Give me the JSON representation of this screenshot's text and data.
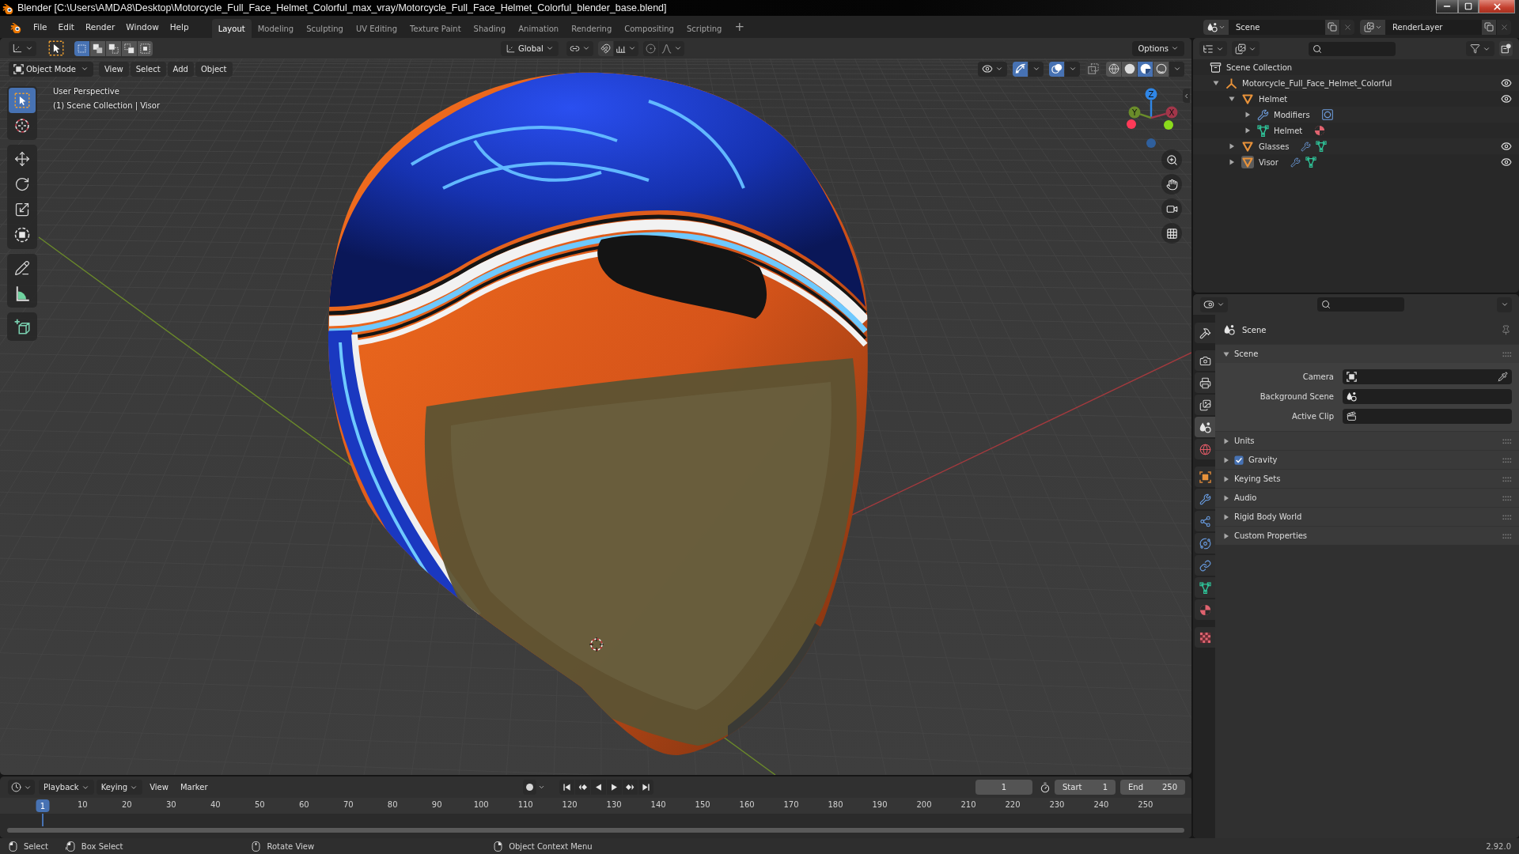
{
  "window": {
    "title": "Blender [C:\\Users\\AMDA8\\Desktop\\Motorcycle_Full_Face_Helmet_Colorful_max_vray/Motorcycle_Full_Face_Helmet_Colorful_blender_base.blend]"
  },
  "menu_bar": [
    "File",
    "Edit",
    "Render",
    "Window",
    "Help"
  ],
  "workspace_tabs": [
    {
      "label": "Layout",
      "selected": true
    },
    {
      "label": "Modeling",
      "selected": false
    },
    {
      "label": "Sculpting",
      "selected": false
    },
    {
      "label": "UV Editing",
      "selected": false
    },
    {
      "label": "Texture Paint",
      "selected": false
    },
    {
      "label": "Shading",
      "selected": false
    },
    {
      "label": "Animation",
      "selected": false
    },
    {
      "label": "Rendering",
      "selected": false
    },
    {
      "label": "Compositing",
      "selected": false
    },
    {
      "label": "Scripting",
      "selected": false
    }
  ],
  "add_workspace": "+",
  "scene_selector": {
    "scene": "Scene",
    "view_layer": "RenderLayer"
  },
  "viewport": {
    "select_modes": [
      {
        "kind": "set",
        "selected": true
      },
      {
        "kind": "extend",
        "selected": false
      },
      {
        "kind": "subtract",
        "selected": false
      },
      {
        "kind": "difference",
        "selected": false
      },
      {
        "kind": "intersect",
        "selected": false
      }
    ],
    "orientation": "Global",
    "options": "Options",
    "mode": "Object Mode",
    "menus": [
      "View",
      "Select",
      "Add",
      "Object"
    ],
    "toggles": [
      {
        "kind": "gizmos",
        "on": true
      },
      {
        "kind": "overlays",
        "on": true
      },
      {
        "kind": "xray",
        "on": false
      }
    ],
    "shading_modes": [
      {
        "kind": "wireframe",
        "selected": false
      },
      {
        "kind": "solid",
        "selected": false
      },
      {
        "kind": "material",
        "selected": true
      },
      {
        "kind": "rendered",
        "selected": false
      }
    ],
    "overlay_text": [
      "User Perspective",
      "(1) Scene Collection | Visor"
    ],
    "tool_groups": [
      {
        "tools": [
          {
            "kind": "select_box",
            "selected": true
          },
          {
            "kind": "cursor",
            "selected": false
          }
        ]
      },
      {
        "tools": [
          {
            "kind": "move",
            "selected": false
          },
          {
            "kind": "rotate",
            "selected": false
          },
          {
            "kind": "scale",
            "selected": false
          },
          {
            "kind": "transform",
            "selected": false
          }
        ]
      },
      {
        "tools": [
          {
            "kind": "annotate",
            "selected": false
          },
          {
            "kind": "measure",
            "selected": false
          }
        ]
      },
      {
        "tools": [
          {
            "kind": "add_cube",
            "selected": false
          }
        ]
      }
    ],
    "gizmo": {
      "axes": [
        {
          "label": "Z",
          "color": "#2f86e6"
        },
        {
          "label": "Y",
          "color": "#6a8c2a"
        },
        {
          "label": "X",
          "color": "#a2364a"
        }
      ],
      "negative_axes": [
        {
          "color": "#2f5f9c"
        },
        {
          "color": "#8bdb1c"
        },
        {
          "color": "#ff3a58"
        }
      ]
    }
  },
  "timeline": {
    "menus": [
      {
        "label": "Playback",
        "dropdown": true
      },
      {
        "label": "Keying",
        "dropdown": true
      },
      {
        "label": "View",
        "dropdown": false
      },
      {
        "label": "Marker",
        "dropdown": false
      }
    ],
    "current_frame": "1",
    "start_label": "Start",
    "start": "1",
    "end_label": "End",
    "end": "250",
    "playhead": "1",
    "frame_labels": [
      "10",
      "20",
      "30",
      "40",
      "50",
      "60",
      "70",
      "80",
      "90",
      "100",
      "110",
      "120",
      "130",
      "140",
      "150",
      "160",
      "170",
      "180",
      "190",
      "200",
      "210",
      "220",
      "230",
      "240",
      "250"
    ]
  },
  "outliner": {
    "tree": [
      {
        "label": "Scene Collection",
        "kind": "collection",
        "selected": false,
        "children": [
          {
            "label": "Motorcycle_Full_Face_Helmet_Colorful",
            "kind": "empty",
            "expanded": true,
            "visible": true,
            "selected": false,
            "children": [
              {
                "label": "Helmet",
                "kind": "object",
                "expanded": true,
                "visible": true,
                "selected": false,
                "active": false,
                "children": [
                  {
                    "label": "Modifiers",
                    "kind": "modifiers",
                    "expanded": false,
                    "selected": false,
                    "badges": [
                      {
                        "kind": "subsurf"
                      }
                    ]
                  },
                  {
                    "label": "Helmet",
                    "kind": "mesh",
                    "expanded": false,
                    "selected": false,
                    "badges": [
                      {
                        "kind": "material"
                      }
                    ]
                  }
                ]
              },
              {
                "label": "Glasses",
                "kind": "object",
                "expanded": false,
                "visible": true,
                "selected": false,
                "active": false,
                "badges": [
                  {
                    "kind": "modifier"
                  },
                  {
                    "kind": "mesh"
                  }
                ]
              },
              {
                "label": "Visor",
                "kind": "object",
                "expanded": false,
                "visible": true,
                "selected": false,
                "active": true,
                "badges": [
                  {
                    "kind": "modifier"
                  },
                  {
                    "kind": "mesh"
                  }
                ]
              }
            ]
          }
        ]
      }
    ]
  },
  "properties": {
    "tab_groups": [
      {
        "tabs": [
          {
            "kind": "tool",
            "selected": false
          }
        ]
      },
      {
        "tabs": [
          {
            "kind": "render",
            "selected": false
          },
          {
            "kind": "output",
            "selected": false
          },
          {
            "kind": "view_layer",
            "selected": false
          },
          {
            "kind": "scene",
            "selected": true
          },
          {
            "kind": "world",
            "selected": false
          }
        ]
      },
      {
        "tabs": [
          {
            "kind": "object",
            "selected": false
          },
          {
            "kind": "modifiers",
            "selected": false
          },
          {
            "kind": "particles",
            "selected": false
          },
          {
            "kind": "physics",
            "selected": false
          },
          {
            "kind": "constraints",
            "selected": false
          },
          {
            "kind": "data",
            "selected": false
          },
          {
            "kind": "material",
            "selected": false
          }
        ]
      },
      {
        "tabs": [
          {
            "kind": "texture",
            "selected": false
          }
        ]
      }
    ],
    "context": "Scene",
    "panels": [
      {
        "title": "Scene",
        "expanded": true,
        "fields": [
          {
            "label": "Camera",
            "kind": "camera"
          },
          {
            "label": "Background Scene",
            "kind": "scene"
          },
          {
            "label": "Active Clip",
            "kind": "clip"
          }
        ]
      },
      {
        "title": "Units",
        "expanded": false
      },
      {
        "title": "Gravity",
        "expanded": false,
        "checked": true
      },
      {
        "title": "Keying Sets",
        "expanded": false
      },
      {
        "title": "Audio",
        "expanded": false
      },
      {
        "title": "Rigid Body World",
        "expanded": false
      },
      {
        "title": "Custom Properties",
        "expanded": false
      }
    ]
  },
  "status_bar": {
    "hints": [
      {
        "kind": "left_click",
        "label": "Select"
      },
      {
        "kind": "drag",
        "label": "Box Select"
      },
      {
        "kind": "middle_click",
        "label": "Rotate View"
      },
      {
        "kind": "right_click",
        "label": "Object Context Menu"
      }
    ],
    "version": "2.92.0"
  }
}
